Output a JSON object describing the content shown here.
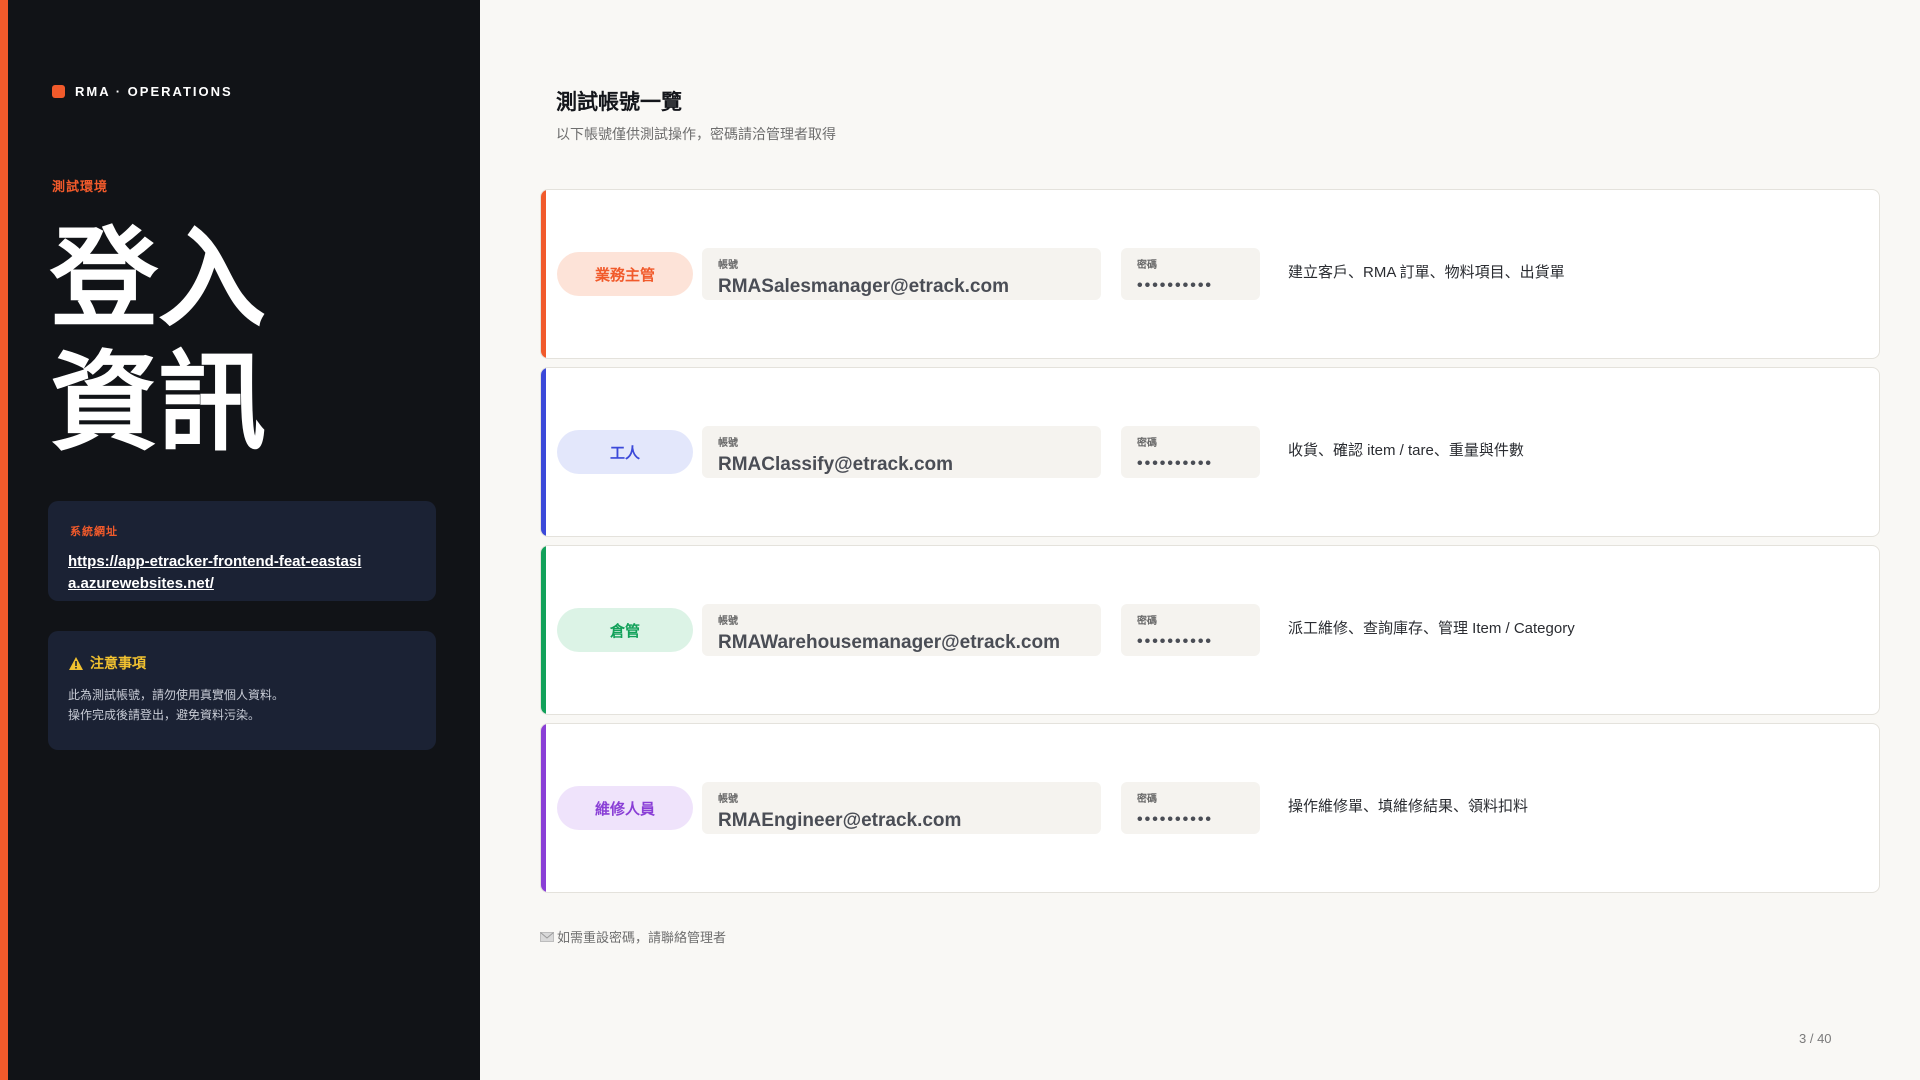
{
  "brand": "RMA · OPERATIONS",
  "env_label": "測試環境",
  "title_line1": "登入",
  "title_line2": "資訊",
  "url_card": {
    "label": "系統網址",
    "url": "https://app-etracker-frontend-feat-eastasia.azurewebsites.net/"
  },
  "note_card": {
    "title": "注意事項",
    "line1": "此為測試帳號，請勿使用真實個人資料。",
    "line2": "操作完成後請登出，避免資料污染。"
  },
  "main": {
    "title": "測試帳號一覽",
    "subtitle": "以下帳號僅供測試操作，密碼請洽管理者取得"
  },
  "colors": {
    "accent": "#f15a2b",
    "sales": "#f15a2b",
    "worker": "#3b49d9",
    "warehouse": "#12a15a",
    "engineer": "#8a3fd6"
  },
  "accounts": [
    {
      "role": "業務主管",
      "account_label": "帳號",
      "account": "RMASalesmanager@etrack.com",
      "password_label": "密碼",
      "password": "••••••••••",
      "description": "建立客戶、RMA 訂單、物料項目、出貨單"
    },
    {
      "role": "工人",
      "account_label": "帳號",
      "account": "RMAClassify@etrack.com",
      "password_label": "密碼",
      "password": "••••••••••",
      "description": "收貨、確認 item / tare、重量與件數"
    },
    {
      "role": "倉管",
      "account_label": "帳號",
      "account": "RMAWarehousemanager@etrack.com",
      "password_label": "密碼",
      "password": "••••••••••",
      "description": "派工維修、查詢庫存、管理 Item / Category"
    },
    {
      "role": "維修人員",
      "account_label": "帳號",
      "account": "RMAEngineer@etrack.com",
      "password_label": "密碼",
      "password": "••••••••••",
      "description": "操作維修單、填維修結果、領料扣料"
    }
  ],
  "footer_note": "如需重設密碼，請聯絡管理者",
  "footer_icon": "mail-icon",
  "page_number": "3 / 40"
}
